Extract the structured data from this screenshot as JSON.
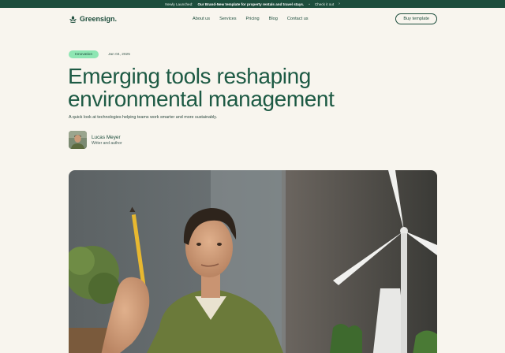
{
  "banner": {
    "prefix": "Newly Launched:",
    "highlight": "Our Brand-New template for property rentals and travel stays.",
    "separator": "•",
    "cta": "Check it out",
    "cta_arrow": "›"
  },
  "brand": {
    "name": "Greensign."
  },
  "nav": {
    "items": [
      {
        "label": "About us"
      },
      {
        "label": "Services"
      },
      {
        "label": "Pricing"
      },
      {
        "label": "Blog"
      },
      {
        "label": "Contact us"
      }
    ],
    "cta_label": "Buy template"
  },
  "article": {
    "tag": "Innovation",
    "date": "Jan 04, 2025",
    "title": "Emerging tools reshaping environmental management",
    "subtitle": "A quick look at technologies helping teams work smarter and more sustainably.",
    "author": {
      "name": "Lucas Meyer",
      "role": "Writer and author"
    }
  },
  "colors": {
    "background": "#f8f5ee",
    "brand_green": "#1d4d3c",
    "tag_green": "#8ee6b3",
    "title_green": "#1d5a44"
  },
  "icons": {
    "logo": "leaf-logo-icon",
    "arrow": "chevron-right-icon"
  }
}
